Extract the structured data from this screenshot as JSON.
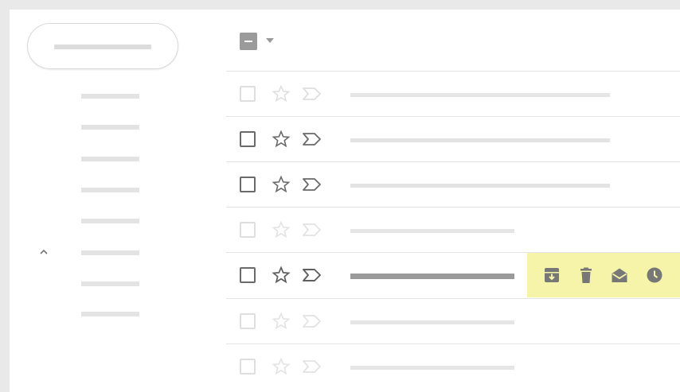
{
  "colors": {
    "hover_highlight": "#f6f4a8",
    "action_icon": "#777777",
    "placeholder_line": "#e3e3e3",
    "dark_icon": "#6a6a6a"
  },
  "sidebar": {
    "compose_icon": "compose-placeholder",
    "nav_item_count": 8,
    "collapse_icon": "chevron-up-icon"
  },
  "toolbar": {
    "select_all_state": "indeterminate",
    "select_dropdown_icon": "caret-down-icon"
  },
  "rows": [
    {
      "state": "faded"
    },
    {
      "state": "active"
    },
    {
      "state": "active"
    },
    {
      "state": "faded"
    },
    {
      "state": "hovered",
      "actions": [
        "archive-icon",
        "delete-icon",
        "mark-as-read-icon",
        "snooze-icon"
      ]
    },
    {
      "state": "faded"
    },
    {
      "state": "faded"
    }
  ]
}
